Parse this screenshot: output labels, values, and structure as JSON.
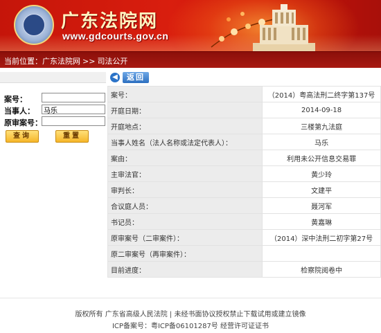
{
  "header": {
    "site_title": "广东法院网",
    "site_url": "www.gdcourts.gov.cn"
  },
  "breadcrumb": {
    "prefix": "当前位置：",
    "items": [
      "广东法院网",
      "司法公开"
    ],
    "separator": ">>"
  },
  "search": {
    "case_no_label": "案号：",
    "case_no_value": "",
    "party_label": "当事人：",
    "party_value": "马乐",
    "original_case_label": "原审案号：",
    "original_case_value": "",
    "query_button": "查询",
    "reset_button": "重置"
  },
  "detail": {
    "back_label": "返回",
    "rows": [
      {
        "label": "案号：",
        "value": "（2014）粤高法刑二终字第137号"
      },
      {
        "label": "开庭日期：",
        "value": "2014-09-18"
      },
      {
        "label": "开庭地点：",
        "value": "三楼第九法庭"
      },
      {
        "label": "当事人姓名（法人名称或法定代表人）：",
        "value": "马乐"
      },
      {
        "label": "案由：",
        "value": "利用未公开信息交易罪"
      },
      {
        "label": "主审法官：",
        "value": "黄少玲"
      },
      {
        "label": "审判长：",
        "value": "文建平"
      },
      {
        "label": "合议庭人员：",
        "value": "聂河军"
      },
      {
        "label": "书记员：",
        "value": "黄嘉琳"
      },
      {
        "label": "原审案号（二审案件）：",
        "value": "（2014）深中法刑二初字第27号"
      },
      {
        "label": "原二审案号（再审案件）：",
        "value": ""
      },
      {
        "label": "目前进度：",
        "value": "检察院阅卷中"
      }
    ]
  },
  "footer": {
    "line1": "版权所有 广东省高级人民法院 | 未经书面协议授权禁止下载试用或建立镜像",
    "line2": "ICP备案号：粤ICP备06101287号 经营许可证证书"
  },
  "colors": {
    "banner_red": "#c5150a",
    "breadcrumb_bg": "#8b0f0a",
    "button_gold": "#f6b62a",
    "back_blue": "#2c6fc0",
    "label_cell_bg": "#ececec"
  }
}
